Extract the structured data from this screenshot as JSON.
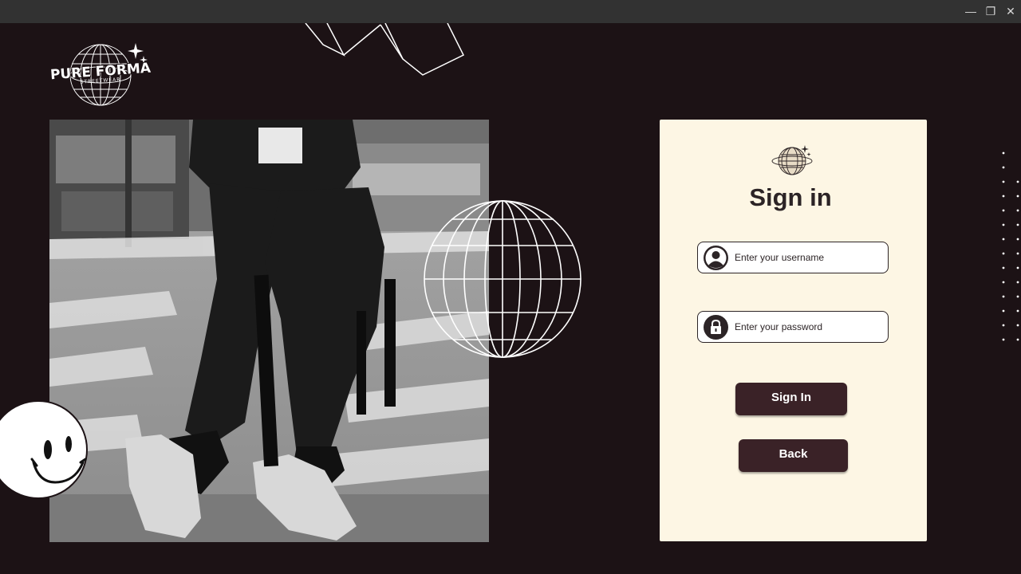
{
  "window": {
    "controls": {
      "minimize": "—",
      "maximize": "❐",
      "close": "✕"
    }
  },
  "logo": {
    "main": "PURE FORMA",
    "sub": "STREETWEAR"
  },
  "photo": {
    "icon": "streetwear-photo"
  },
  "signin": {
    "title": "Sign in",
    "username_placeholder": "Enter your username",
    "password_placeholder": "Enter your password",
    "signin_label": "Sign In",
    "back_label": "Back"
  },
  "colors": {
    "background": "#1c1215",
    "card": "#fdf6e4",
    "button": "#3a2227",
    "text_dark": "#2c2426"
  }
}
